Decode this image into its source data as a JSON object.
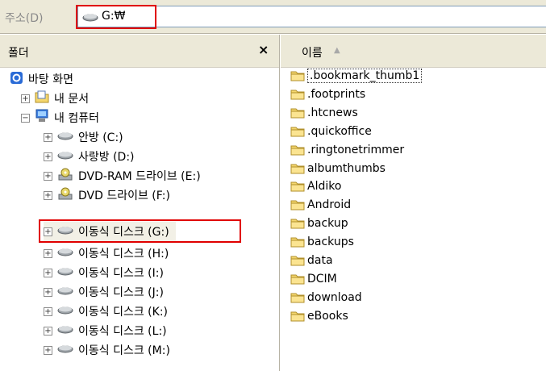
{
  "address": {
    "label": "주소(D)",
    "value": "G:₩"
  },
  "folders_pane": {
    "title": "폴더",
    "close": "×",
    "tree": [
      {
        "label": "바탕 화면",
        "icon": "desktop-icon",
        "expander": ""
      },
      {
        "label": "내 문서",
        "icon": "my-documents-icon",
        "expander": "⊞"
      },
      {
        "label": "내 컴퓨터",
        "icon": "my-computer-icon",
        "expander": "⊟"
      },
      {
        "label": "안방 (C:)",
        "icon": "drive-icon",
        "expander": "⊞"
      },
      {
        "label": "사랑방 (D:)",
        "icon": "drive-icon",
        "expander": "⊞"
      },
      {
        "label": "DVD-RAM 드라이브 (E:)",
        "icon": "dvd-drive-icon",
        "expander": "⊞"
      },
      {
        "label": "DVD 드라이브 (F:)",
        "icon": "dvd-drive-icon",
        "expander": "⊞"
      },
      {
        "label": "이동식 디스크 (G:)",
        "icon": "removable-disk-icon",
        "expander": "⊞"
      },
      {
        "label": "이동식 디스크 (H:)",
        "icon": "removable-disk-icon",
        "expander": "⊞"
      },
      {
        "label": "이동식 디스크 (I:)",
        "icon": "removable-disk-icon",
        "expander": "⊞"
      },
      {
        "label": "이동식 디스크 (J:)",
        "icon": "removable-disk-icon",
        "expander": "⊞"
      },
      {
        "label": "이동식 디스크 (K:)",
        "icon": "removable-disk-icon",
        "expander": "⊞"
      },
      {
        "label": "이동식 디스크 (L:)",
        "icon": "removable-disk-icon",
        "expander": "⊞"
      },
      {
        "label": "이동식 디스크 (M:)",
        "icon": "removable-disk-icon",
        "expander": "⊞"
      }
    ]
  },
  "file_list": {
    "column": "이름",
    "sort_indicator": "▲",
    "items": [
      ".bookmark_thumb1",
      ".footprints",
      ".htcnews",
      ".quickoffice",
      ".ringtonetrimmer",
      "albumthumbs",
      "Aldiko",
      "Android",
      "backup",
      "backups",
      "data",
      "DCIM",
      "download",
      "eBooks"
    ]
  },
  "colors": {
    "highlight": "#e00000",
    "folder": "#f5d76e",
    "chrome": "#ece9d8"
  }
}
